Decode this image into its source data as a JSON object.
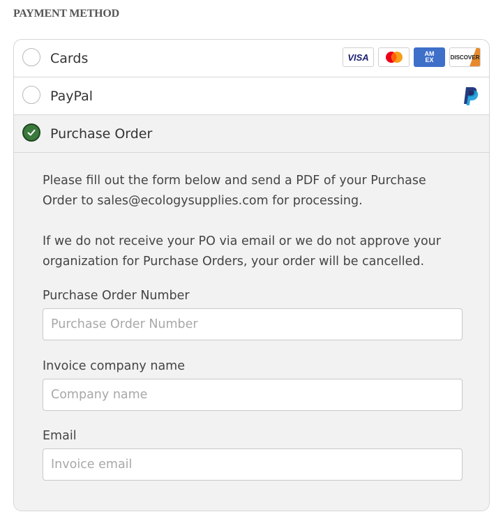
{
  "section": {
    "title": "PAYMENT METHOD"
  },
  "options": {
    "cards": {
      "label": "Cards",
      "logos": [
        "VISA",
        "Mastercard",
        "AMEX",
        "DISCOVER"
      ],
      "selected": false
    },
    "paypal": {
      "label": "PayPal",
      "icon": "paypal-icon",
      "selected": false
    },
    "purchase_order": {
      "label": "Purchase Order",
      "selected": true
    }
  },
  "po_panel": {
    "paragraph1": "Please fill out the form below and send a PDF of your Purchase Order to sales@ecologysupplies.com for processing.",
    "paragraph2": "If we do not receive your PO via email or we do not approve your organization for Purchase Orders, your order will be cancelled.",
    "fields": {
      "po_number": {
        "label": "Purchase Order Number",
        "placeholder": "Purchase Order Number",
        "value": ""
      },
      "company": {
        "label": "Invoice company name",
        "placeholder": "Company name",
        "value": ""
      },
      "email": {
        "label": "Email",
        "placeholder": "Invoice email",
        "value": ""
      }
    }
  },
  "colors": {
    "selected_radio": "#3a7a3c",
    "panel_bg": "#f2f2f2",
    "border": "#d6d6d6"
  }
}
